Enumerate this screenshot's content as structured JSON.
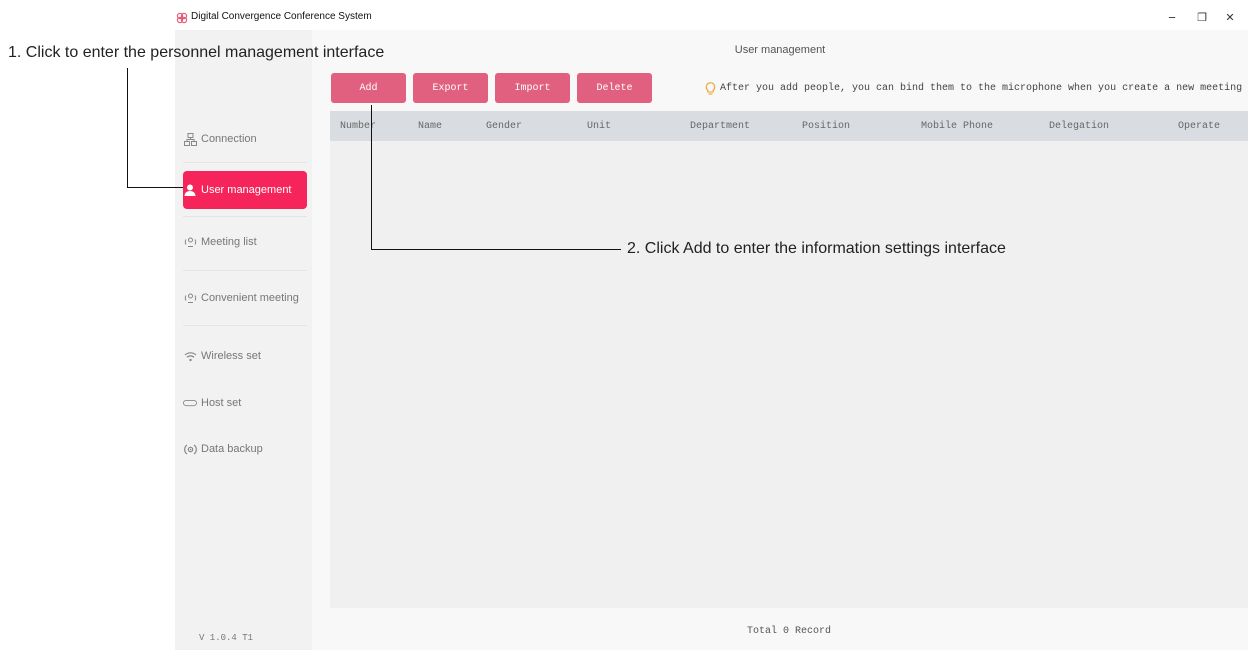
{
  "window": {
    "title": "Digital Convergence Conference System",
    "minimize_glyph": "−",
    "restore_glyph": "❐",
    "close_glyph": "✕"
  },
  "sidebar": {
    "items": [
      {
        "label": "Connection",
        "icon": "network-icon"
      },
      {
        "label": "User management",
        "icon": "user-icon"
      },
      {
        "label": "Meeting list",
        "icon": "meeting-icon"
      },
      {
        "label": "Convenient meeting",
        "icon": "meeting-icon"
      },
      {
        "label": "Wireless set",
        "icon": "wifi-icon"
      },
      {
        "label": "Host set",
        "icon": "host-icon"
      },
      {
        "label": "Data backup",
        "icon": "backup-icon"
      }
    ],
    "active_index": 1,
    "version": "V 1.0.4 T1"
  },
  "main": {
    "title": "User management",
    "toolbar": {
      "add": "Add",
      "export": "Export",
      "import": "Import",
      "delete": "Delete"
    },
    "tip": "After you add people, you can bind them to the microphone when you create a new meeting",
    "table": {
      "columns": [
        "Number",
        "Name",
        "Gender",
        "Unit",
        "Department",
        "Position",
        "Mobile Phone",
        "Delegation",
        "Operate"
      ],
      "rows": []
    },
    "footer": "Total 0 Record"
  },
  "annotations": {
    "step1": "1. Click to enter the personnel management interface",
    "step2": "2. Click Add to enter the information settings interface"
  },
  "colors": {
    "active_nav": "#f5245a",
    "button": "#e2607f",
    "tip_icon": "#f0a030"
  }
}
